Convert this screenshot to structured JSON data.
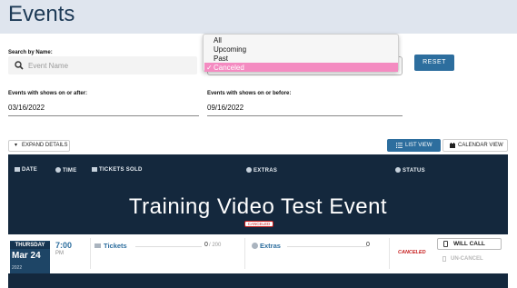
{
  "page": {
    "title": "Events"
  },
  "filters": {
    "search_label": "Search by Name:",
    "search_placeholder": "Event Name",
    "status_dropdown": {
      "options": [
        "All",
        "Upcoming",
        "Past",
        "Canceled"
      ],
      "selected": "Canceled",
      "check": "✓"
    },
    "reset_label": "RESET",
    "after_label": "Events with shows on or after:",
    "after_value": "03/16/2022",
    "before_label": "Events with shows on or before:",
    "before_value": "09/16/2022"
  },
  "toolbar": {
    "expand_caret": "▾",
    "expand_label": "EXPAND DETAILS",
    "list_view_label": "LIST VIEW",
    "calendar_view_label": "CALENDAR VIEW"
  },
  "table": {
    "headers": {
      "date": "DATE",
      "time": "TIME",
      "tickets_sold": "TICKETS SOLD",
      "extras": "EXTRAS",
      "status": "STATUS"
    },
    "event": {
      "title": "Training Video Test Event",
      "badge": "CANCELED",
      "show": {
        "day_of_week": "THURSDAY",
        "month_day": "Mar 24",
        "year": "2022",
        "time": "7:00",
        "ampm": "PM",
        "tickets_label": "Tickets",
        "tickets_sold": "0",
        "tickets_capacity": "/ 200",
        "extras_label": "Extras",
        "extras_count": "0",
        "status": "CANCELED",
        "will_call_label": "WILL CALL",
        "uncancel_label": "UN-CANCEL"
      }
    }
  },
  "colors": {
    "accent": "#2d6e9e",
    "header_bg": "#dfe5ee",
    "table_bg": "#14283d",
    "selected_option": "#f48bc1",
    "canceled": "#c61c1c"
  }
}
